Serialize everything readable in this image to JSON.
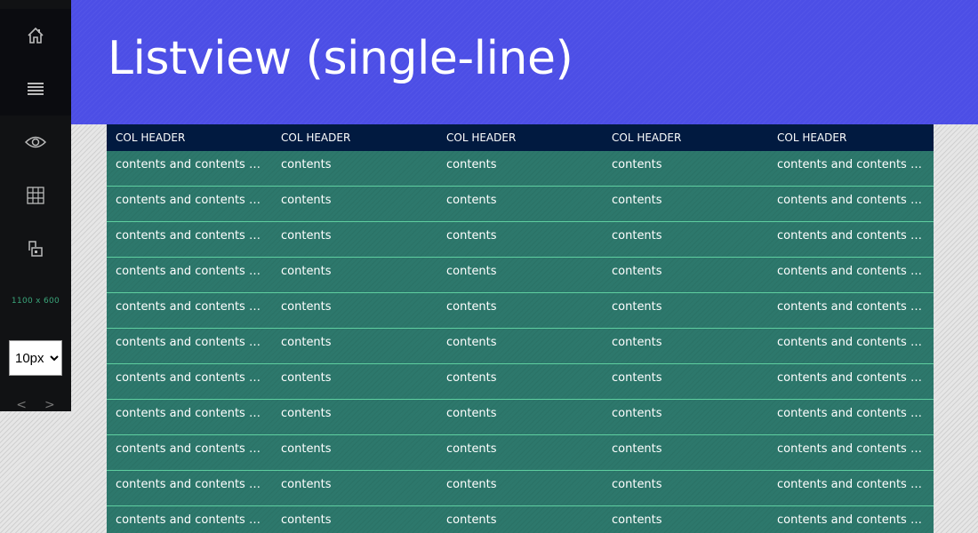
{
  "page": {
    "title": "Listview (single-line)"
  },
  "sidebar": {
    "icons": [
      "home-icon",
      "menu-icon",
      "eye-icon",
      "grid-icon",
      "layout-icon"
    ],
    "size_readout": "1100 x 600",
    "font_size_select": {
      "selected": "10px",
      "options": [
        "10px"
      ]
    },
    "prev_label": "<",
    "next_label": ">"
  },
  "listview": {
    "columns": [
      "COL HEADER",
      "COL HEADER",
      "COL HEADER",
      "COL HEADER",
      "COL HEADER"
    ],
    "rows": [
      [
        "contents and contents and contents",
        "contents",
        "contents",
        "contents",
        "contents and contents and contents"
      ],
      [
        "contents and contents and contents",
        "contents",
        "contents",
        "contents",
        "contents and contents and contents"
      ],
      [
        "contents and contents and contents",
        "contents",
        "contents",
        "contents",
        "contents and contents and contents"
      ],
      [
        "contents and contents and contents",
        "contents",
        "contents",
        "contents",
        "contents and contents and contents"
      ],
      [
        "contents and contents and contents",
        "contents",
        "contents",
        "contents",
        "contents and contents and contents"
      ],
      [
        "contents and contents and contents",
        "contents",
        "contents",
        "contents",
        "contents and contents and contents"
      ],
      [
        "contents and contents and contents",
        "contents",
        "contents",
        "contents",
        "contents and contents and contents"
      ],
      [
        "contents and contents and contents",
        "contents",
        "contents",
        "contents",
        "contents and contents and contents"
      ],
      [
        "contents and contents and contents",
        "contents",
        "contents",
        "contents",
        "contents and contents and contents"
      ],
      [
        "contents and contents and contents",
        "contents",
        "contents",
        "contents",
        "contents and contents and contents"
      ],
      [
        "contents and contents and contents",
        "contents",
        "contents",
        "contents",
        "contents and contents and contents"
      ]
    ]
  },
  "colors": {
    "header_bg": "#4c4ee6",
    "sidebar_bg": "#111214",
    "list_header_bg": "#011a40",
    "row_bg": "#2d786c",
    "row_divider": "#5fcfa0",
    "readout_text": "#3aa57a"
  }
}
